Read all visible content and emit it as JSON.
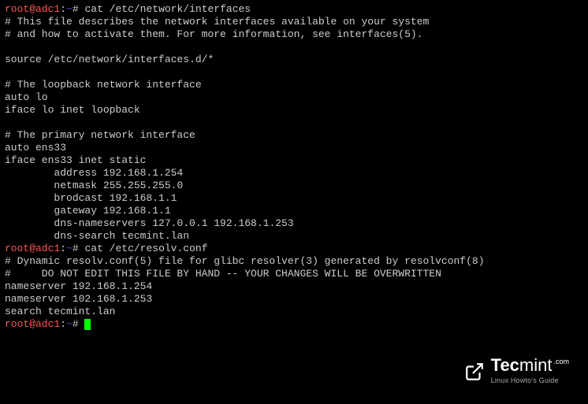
{
  "prompt": {
    "user_host": "root@adc1",
    "colon": ":",
    "cwd": "~",
    "symbol": "#"
  },
  "commands": {
    "cmd1": "cat /etc/network/interfaces",
    "cmd2": "cat /etc/resolv.conf"
  },
  "output1": {
    "l1": "# This file describes the network interfaces available on your system",
    "l2": "# and how to activate them. For more information, see interfaces(5).",
    "l3": "",
    "l4": "source /etc/network/interfaces.d/*",
    "l5": "",
    "l6": "# The loopback network interface",
    "l7": "auto lo",
    "l8": "iface lo inet loopback",
    "l9": "",
    "l10": "# The primary network interface",
    "l11": "auto ens33",
    "l12": "iface ens33 inet static",
    "l13": "        address 192.168.1.254",
    "l14": "        netmask 255.255.255.0",
    "l15": "        brodcast 192.168.1.1",
    "l16": "        gateway 192.168.1.1",
    "l17": "        dns-nameservers 127.0.0.1 192.168.1.253",
    "l18": "        dns-search tecmint.lan"
  },
  "output2": {
    "l1": "# Dynamic resolv.conf(5) file for glibc resolver(3) generated by resolvconf(8)",
    "l2": "#     DO NOT EDIT THIS FILE BY HAND -- YOUR CHANGES WILL BE OVERWRITTEN",
    "l3": "nameserver 192.168.1.254",
    "l4": "nameserver 102.168.1.253",
    "l5": "search tecmint.lan"
  },
  "watermark": {
    "brand_bold": "Tec",
    "brand_light": "mint",
    "dotcom": ".com",
    "tagline": "Linux Howto's Guide"
  }
}
